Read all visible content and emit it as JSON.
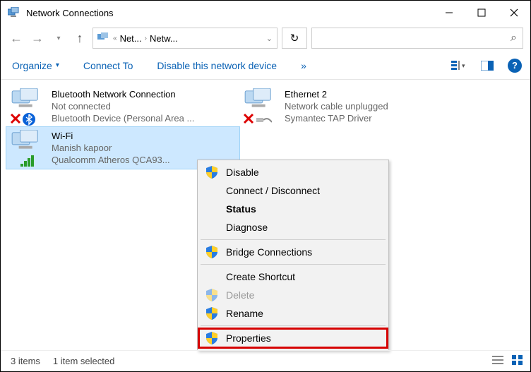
{
  "window": {
    "title": "Network Connections"
  },
  "address": {
    "seg1": "Net...",
    "seg2": "Netw..."
  },
  "cmdbar": {
    "organize": "Organize",
    "connect_to": "Connect To",
    "disable_device": "Disable this network device",
    "more": "»"
  },
  "connections": [
    {
      "name": "Bluetooth Network Connection",
      "status": "Not connected",
      "device": "Bluetooth Device (Personal Area ...",
      "overlay": "x-bt"
    },
    {
      "name": "Ethernet 2",
      "status": "Network cable unplugged",
      "device": "Symantec TAP Driver",
      "overlay": "x"
    },
    {
      "name": "Wi-Fi",
      "status": "Manish kapoor",
      "device": "Qualcomm Atheros QCA93...",
      "overlay": "wifi",
      "selected": true
    }
  ],
  "context_menu": {
    "disable": "Disable",
    "connect_disconnect": "Connect / Disconnect",
    "status": "Status",
    "diagnose": "Diagnose",
    "bridge": "Bridge Connections",
    "create_shortcut": "Create Shortcut",
    "delete": "Delete",
    "rename": "Rename",
    "properties": "Properties"
  },
  "statusbar": {
    "items": "3 items",
    "selected": "1 item selected"
  }
}
